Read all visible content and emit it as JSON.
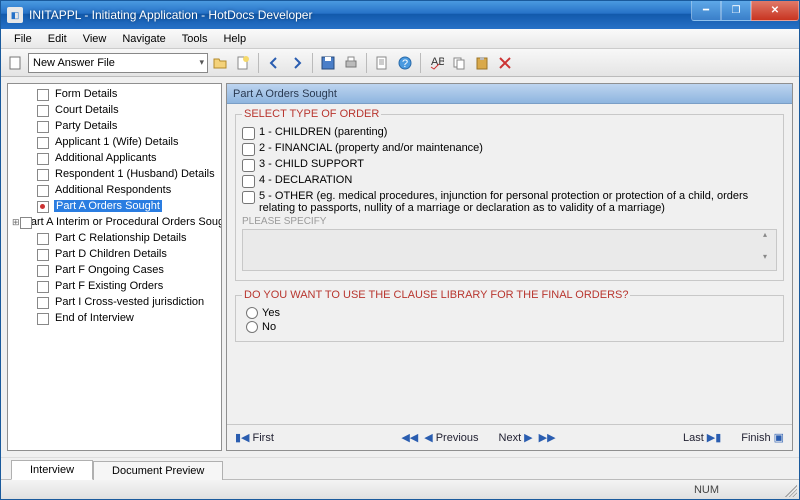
{
  "window": {
    "title": "INITAPPL - Initiating Application - HotDocs Developer"
  },
  "menubar": [
    "File",
    "Edit",
    "View",
    "Navigate",
    "Tools",
    "Help"
  ],
  "toolbar": {
    "answer_file": "New Answer File"
  },
  "sidebar": {
    "items": [
      {
        "label": "Form Details",
        "selected": false,
        "dot": false,
        "expander": ""
      },
      {
        "label": "Court Details",
        "selected": false,
        "dot": false,
        "expander": ""
      },
      {
        "label": "Party Details",
        "selected": false,
        "dot": false,
        "expander": ""
      },
      {
        "label": "Applicant 1 (Wife) Details",
        "selected": false,
        "dot": false,
        "expander": ""
      },
      {
        "label": "Additional Applicants",
        "selected": false,
        "dot": false,
        "expander": ""
      },
      {
        "label": "Respondent 1 (Husband) Details",
        "selected": false,
        "dot": false,
        "expander": ""
      },
      {
        "label": "Additional Respondents",
        "selected": false,
        "dot": false,
        "expander": ""
      },
      {
        "label": "Part A Orders Sought",
        "selected": true,
        "dot": true,
        "expander": ""
      },
      {
        "label": "Part A Interim or Procedural Orders Sought",
        "selected": false,
        "dot": false,
        "expander": "⊞"
      },
      {
        "label": "Part C Relationship Details",
        "selected": false,
        "dot": false,
        "expander": ""
      },
      {
        "label": "Part D Children Details",
        "selected": false,
        "dot": false,
        "expander": ""
      },
      {
        "label": "Part F Ongoing Cases",
        "selected": false,
        "dot": false,
        "expander": ""
      },
      {
        "label": "Part F Existing Orders",
        "selected": false,
        "dot": false,
        "expander": ""
      },
      {
        "label": "Part I Cross-vested jurisdiction",
        "selected": false,
        "dot": false,
        "expander": ""
      },
      {
        "label": "End of Interview",
        "selected": false,
        "dot": false,
        "expander": ""
      }
    ]
  },
  "panel": {
    "title": "Part A Orders Sought",
    "group1": {
      "legend": "SELECT TYPE OF ORDER",
      "opts": [
        "1 - CHILDREN (parenting)",
        "2 - FINANCIAL (property and/or maintenance)",
        "3 - CHILD SUPPORT",
        "4 - DECLARATION",
        "5 - OTHER (eg. medical procedures, injunction for personal protection or protection of a child, orders relating to passports, nullity of a marriage or declaration as to validity of a marriage)"
      ],
      "specify_label": "PLEASE SPECIFY"
    },
    "group2": {
      "legend": "DO YOU WANT TO USE THE CLAUSE LIBRARY FOR THE FINAL ORDERS?",
      "yes": "Yes",
      "no": "No"
    }
  },
  "nav": {
    "first": "First",
    "previous": "Previous",
    "next": "Next",
    "last": "Last",
    "finish": "Finish"
  },
  "tabs": {
    "interview": "Interview",
    "preview": "Document Preview"
  },
  "status": {
    "num": "NUM"
  }
}
